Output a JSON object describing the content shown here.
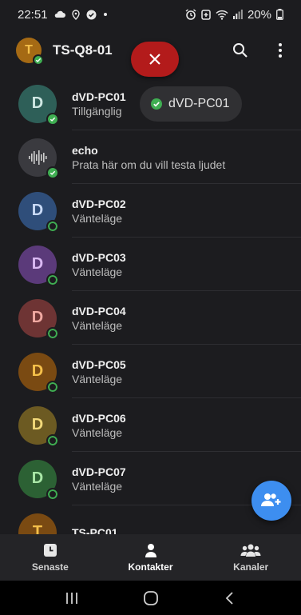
{
  "statusbar": {
    "time": "22:51",
    "battery": "20%"
  },
  "header": {
    "self_initial": "T",
    "title": "TS-Q8-01"
  },
  "tooltip": {
    "text": "dVD-PC01"
  },
  "contacts": [
    {
      "initial": "D",
      "name": "dVD-PC01",
      "status": "Tillgänglig",
      "bg": "#2e5f58",
      "fg": "#cfe7e3",
      "state": "online"
    },
    {
      "initial": "",
      "name": "echo",
      "status": "Prata här om du vill testa ljudet",
      "bg": "#3a3a3f",
      "fg": "#d0d0d0",
      "state": "online",
      "icon": "waveform-icon"
    },
    {
      "initial": "D",
      "name": "dVD-PC02",
      "status": "Vänteläge",
      "bg": "#2f4e7a",
      "fg": "#c9daf6",
      "state": "idle"
    },
    {
      "initial": "D",
      "name": "dVD-PC03",
      "status": "Vänteläge",
      "bg": "#5b3a7a",
      "fg": "#dab9f3",
      "state": "idle"
    },
    {
      "initial": "D",
      "name": "dVD-PC04",
      "status": "Vänteläge",
      "bg": "#6e3434",
      "fg": "#f0a9a2",
      "state": "idle"
    },
    {
      "initial": "D",
      "name": "dVD-PC05",
      "status": "Vänteläge",
      "bg": "#7a4a12",
      "fg": "#f5c04a",
      "state": "idle"
    },
    {
      "initial": "D",
      "name": "dVD-PC06",
      "status": "Vänteläge",
      "bg": "#6c5a22",
      "fg": "#f2d97a",
      "state": "idle"
    },
    {
      "initial": "D",
      "name": "dVD-PC07",
      "status": "Vänteläge",
      "bg": "#2c6134",
      "fg": "#a9e7a7",
      "state": "idle"
    },
    {
      "initial": "T",
      "name": "TS-PC01",
      "status": "",
      "bg": "#7a4a12",
      "fg": "#f5c04a",
      "state": "idle"
    }
  ],
  "bottomnav": {
    "tabs": [
      {
        "label": "Senaste",
        "icon": "clock-icon"
      },
      {
        "label": "Kontakter",
        "icon": "person-icon"
      },
      {
        "label": "Kanaler",
        "icon": "group-icon"
      }
    ]
  },
  "colors": {
    "accent": "#3d8ef0",
    "online": "#3fae52",
    "danger": "#b31b1b"
  }
}
